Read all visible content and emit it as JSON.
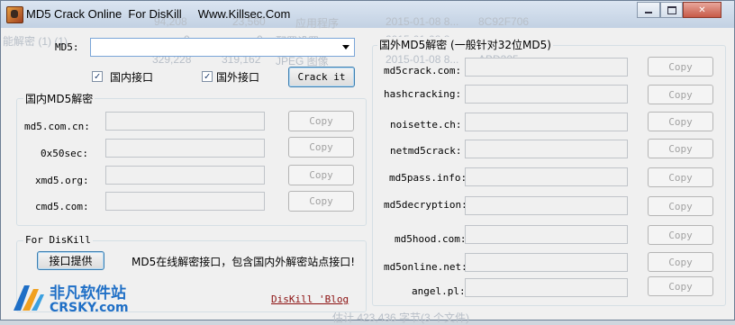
{
  "window": {
    "title": "MD5 Crack Online  For DisKill     Www.Killsec.Com"
  },
  "background_ghost": [
    "94,208",
    "23,560",
    "应用程序",
    "2015-01-08 8...",
    "8C92F706",
    "能解密 (1) (1)",
    "0",
    "0",
    "配置设置",
    "2015-01-08 8...",
    "...",
    "329,228",
    "319,162",
    "JPEG 图像",
    "2015-01-08 8...",
    "ABD325...",
    "估计 423,436 字节(3 个文件)"
  ],
  "md5": {
    "label": "MD5:",
    "value": ""
  },
  "options": {
    "domestic_label": "国内接口",
    "foreign_label": "国外接口",
    "domestic_checked": true,
    "foreign_checked": true
  },
  "crack_button": "Crack it",
  "domestic": {
    "title": "国内MD5解密",
    "sites": [
      {
        "name": "md5.com.cn:",
        "value": "",
        "copy": "Copy"
      },
      {
        "name": "0x50sec:",
        "value": "",
        "copy": "Copy"
      },
      {
        "name": "xmd5.org:",
        "value": "",
        "copy": "Copy"
      },
      {
        "name": "cmd5.com:",
        "value": "",
        "copy": "Copy"
      }
    ]
  },
  "foreign": {
    "title": "国外MD5解密 (一般针对32位MD5)",
    "sites": [
      {
        "name": "md5crack.com:",
        "value": "",
        "copy": "Copy"
      },
      {
        "name": "hashcracking:",
        "value": "",
        "copy": "Copy"
      },
      {
        "name": "noisette.ch:",
        "value": "",
        "copy": "Copy"
      },
      {
        "name": "netmd5crack:",
        "value": "",
        "copy": "Copy"
      },
      {
        "name": "md5pass.info:",
        "value": "",
        "copy": "Copy"
      },
      {
        "name": "md5decryption:",
        "value": "",
        "copy": "Copy"
      },
      {
        "name": "md5hood.com:",
        "value": "",
        "copy": "Copy"
      },
      {
        "name": "md5online.net:",
        "value": "",
        "copy": "Copy"
      },
      {
        "name": "angel.pl:",
        "value": "",
        "copy": "Copy"
      }
    ]
  },
  "about": {
    "title": "For DisKill",
    "provide_button": "接口提供",
    "description": "MD5在线解密接口，包含国内外解密站点接口!",
    "blog_link": "DisKill 'Blog"
  },
  "watermark": {
    "cn": "非凡软件站",
    "en": "CRSKY.com"
  },
  "colors": {
    "link": "#8b1010",
    "watermark": "#1f6fc6",
    "accent_border": "#7aa6d8"
  }
}
